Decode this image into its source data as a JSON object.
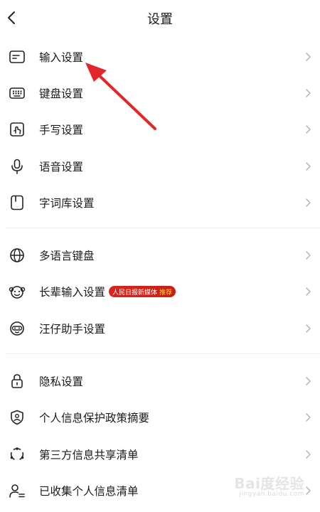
{
  "header": {
    "title": "设置"
  },
  "group1": [
    {
      "name": "input",
      "label": "输入设置",
      "icon": "input-box-icon"
    },
    {
      "name": "keyboard",
      "label": "键盘设置",
      "icon": "keyboard-icon"
    },
    {
      "name": "handwriting",
      "label": "手写设置",
      "icon": "handwriting-icon"
    },
    {
      "name": "voice",
      "label": "语音设置",
      "icon": "microphone-icon"
    },
    {
      "name": "lexicon",
      "label": "字词库设置",
      "icon": "book-icon"
    }
  ],
  "group2": [
    {
      "name": "multilang",
      "label": "多语言键盘",
      "icon": "globe-icon"
    },
    {
      "name": "elder",
      "label": "长辈输入设置",
      "icon": "elder-face-icon",
      "badge": "人民日报新媒体",
      "badge_tag": "推荐"
    },
    {
      "name": "assistant",
      "label": "汪仔助手设置",
      "icon": "dog-mascot-icon"
    }
  ],
  "group3": [
    {
      "name": "privacy",
      "label": "隐私设置",
      "icon": "lock-icon"
    },
    {
      "name": "policy",
      "label": "个人信息保护政策摘要",
      "icon": "shield-user-icon"
    },
    {
      "name": "thirdparty",
      "label": "第三方信息共享清单",
      "icon": "share-circle-icon"
    },
    {
      "name": "collected",
      "label": "已收集个人信息清单",
      "icon": "user-list-icon"
    }
  ],
  "watermark": {
    "main": "Bai度经验",
    "sub": "jingyan.baidu.com"
  }
}
